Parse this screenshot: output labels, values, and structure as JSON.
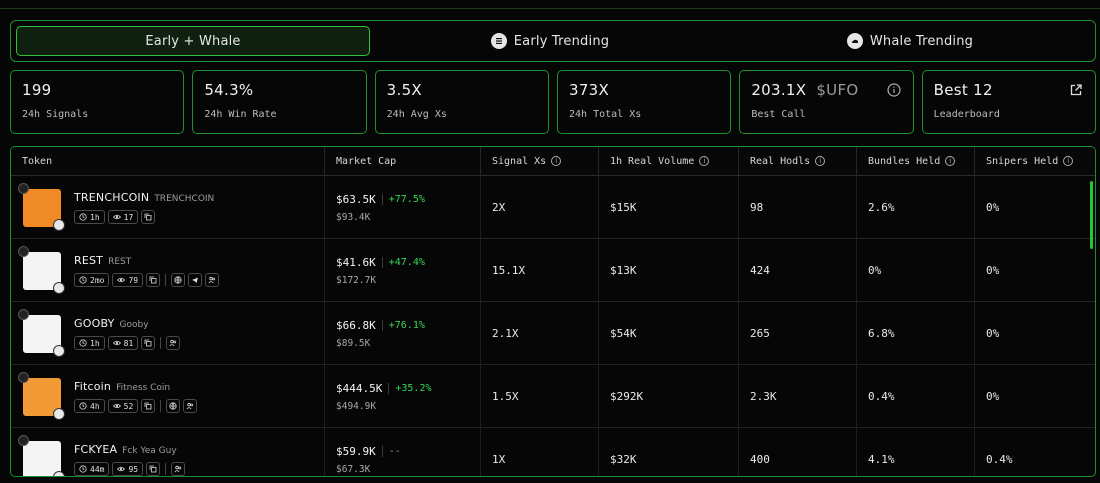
{
  "tabs": [
    {
      "label": "Early + Whale",
      "icon": "",
      "active": true
    },
    {
      "label": "Early Trending",
      "icon": "early-icon",
      "active": false
    },
    {
      "label": "Whale Trending",
      "icon": "whale-icon",
      "active": false
    }
  ],
  "stats": [
    {
      "value": "199",
      "sub": "",
      "label": "24h Signals"
    },
    {
      "value": "54.3%",
      "sub": "",
      "label": "24h Win Rate"
    },
    {
      "value": "3.5X",
      "sub": "",
      "label": "24h Avg Xs"
    },
    {
      "value": "373X",
      "sub": "",
      "label": "24h Total Xs"
    },
    {
      "value": "203.1X",
      "sub": "$UFO",
      "label": "Best Call",
      "icon": "info-icon"
    },
    {
      "value": "Best 12",
      "sub": "",
      "label": "Leaderboard",
      "icon": "external-link-icon"
    }
  ],
  "table": {
    "headers": [
      "Token",
      "Market Cap",
      "Signal Xs",
      "1h Real Volume",
      "Real Hodls",
      "Bundles Held",
      "Snipers Held"
    ],
    "header_info": [
      false,
      false,
      true,
      true,
      true,
      true,
      true
    ],
    "rows": [
      {
        "symbol": "TRENCHCOIN",
        "name": "TRENCHCOIN",
        "age": "1h",
        "views": "17",
        "extras": [],
        "avatar_color": "#f08a24",
        "mcap": "$63.5K",
        "change": "+77.5%",
        "ath": "$93.4K",
        "signal_xs": "2X",
        "volume": "$15K",
        "hodls": "98",
        "bundles": "2.6%",
        "snipers": "0%"
      },
      {
        "symbol": "REST",
        "name": "REST",
        "age": "2mo",
        "views": "79",
        "extras": [
          "globe-icon",
          "telegram-icon",
          "users-icon"
        ],
        "avatar_color": "#f4f4f4",
        "mcap": "$41.6K",
        "change": "+47.4%",
        "ath": "$172.7K",
        "signal_xs": "15.1X",
        "volume": "$13K",
        "hodls": "424",
        "bundles": "0%",
        "snipers": "0%"
      },
      {
        "symbol": "GOOBY",
        "name": "Gooby",
        "age": "1h",
        "views": "81",
        "extras": [
          "users-icon"
        ],
        "avatar_color": "#f4f4f4",
        "mcap": "$66.8K",
        "change": "+76.1%",
        "ath": "$89.5K",
        "signal_xs": "2.1X",
        "volume": "$54K",
        "hodls": "265",
        "bundles": "6.8%",
        "snipers": "0%"
      },
      {
        "symbol": "Fitcoin",
        "name": "Fitness Coin",
        "age": "4h",
        "views": "52",
        "extras": [
          "globe-icon",
          "users-icon"
        ],
        "avatar_color": "#f29a36",
        "mcap": "$444.5K",
        "change": "+35.2%",
        "ath": "$494.9K",
        "signal_xs": "1.5X",
        "volume": "$292K",
        "hodls": "2.3K",
        "bundles": "0.4%",
        "snipers": "0%"
      },
      {
        "symbol": "FCKYEA",
        "name": "Fck Yea Guy",
        "age": "44m",
        "views": "95",
        "extras": [
          "users-icon"
        ],
        "avatar_color": "#f4f4f4",
        "mcap": "$59.9K",
        "change": "--",
        "ath": "$67.3K",
        "signal_xs": "1X",
        "volume": "$32K",
        "hodls": "400",
        "bundles": "4.1%",
        "snipers": "0.4%"
      }
    ]
  },
  "colors": {
    "accent": "#2fc236",
    "positive": "#36d957",
    "border": "#1f8f2a"
  }
}
